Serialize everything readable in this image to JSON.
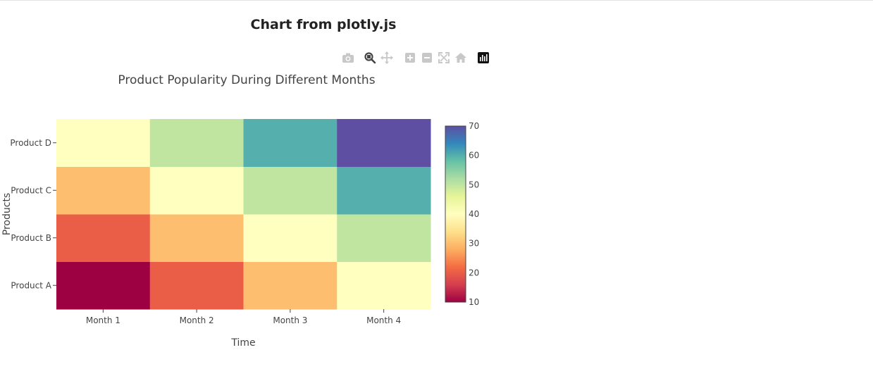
{
  "page": {
    "title": "Chart from plotly.js"
  },
  "modebar": {
    "buttons": [
      {
        "name": "camera-icon",
        "active": false
      },
      {
        "name": "zoom-icon",
        "active": true
      },
      {
        "name": "pan-icon",
        "active": false
      },
      {
        "name": "zoom-in-icon",
        "active": false
      },
      {
        "name": "zoom-out-icon",
        "active": false
      },
      {
        "name": "autoscale-icon",
        "active": false
      },
      {
        "name": "home-icon",
        "active": false
      },
      {
        "name": "plotly-logo-icon",
        "active": false
      }
    ]
  },
  "chart_data": {
    "type": "heatmap",
    "title": "Product Popularity During Different Months",
    "xlabel": "Time",
    "ylabel": "Products",
    "x": [
      "Month 1",
      "Month 2",
      "Month 3",
      "Month 4"
    ],
    "y": [
      "Product A",
      "Product B",
      "Product C",
      "Product D"
    ],
    "z": [
      [
        10,
        20,
        30,
        40
      ],
      [
        20,
        30,
        40,
        50
      ],
      [
        30,
        40,
        50,
        60
      ],
      [
        40,
        50,
        60,
        70
      ]
    ],
    "colorscale": "Spectral",
    "zmin": 10,
    "zmax": 70,
    "colorbar_ticks": [
      10,
      20,
      30,
      40,
      50,
      60,
      70
    ]
  }
}
